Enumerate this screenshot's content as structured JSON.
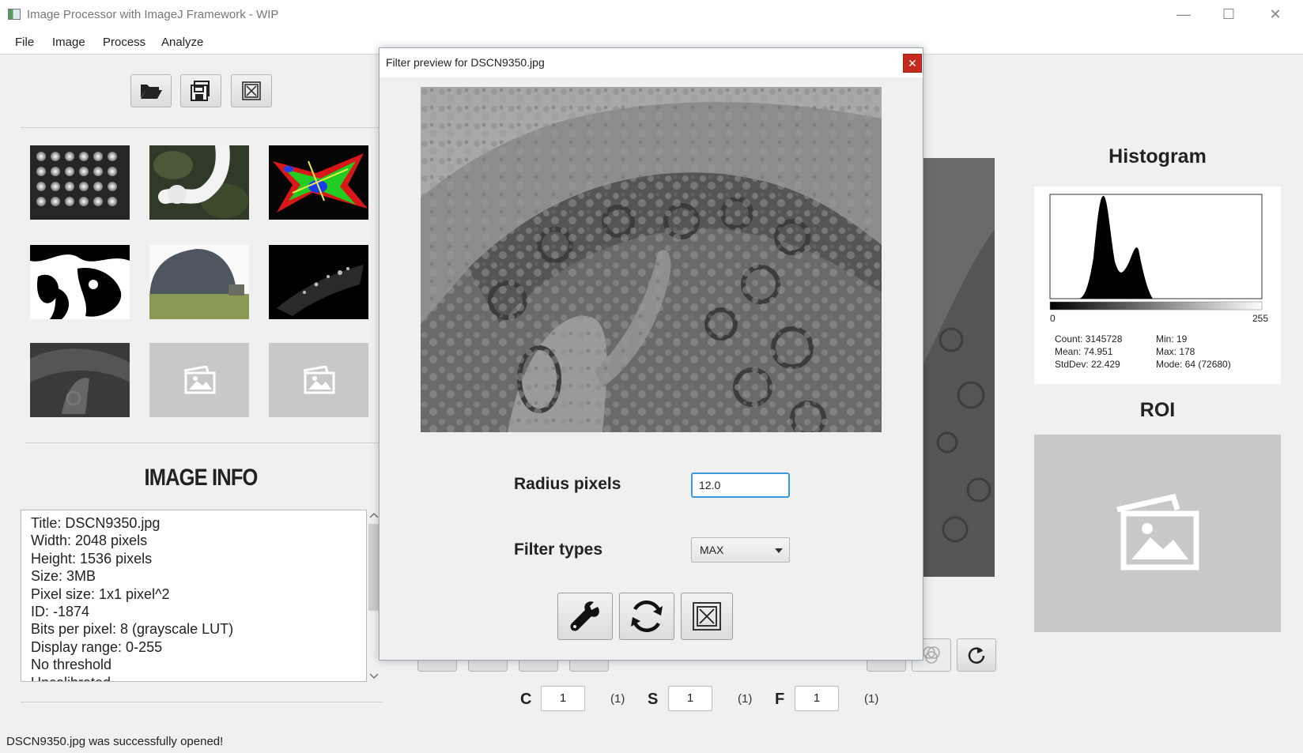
{
  "window": {
    "title": "Image Processor with ImageJ Framework - WIP",
    "minimize_glyph": "—",
    "maximize_glyph": "☐",
    "close_glyph": "✕"
  },
  "menu": [
    "File",
    "Image",
    "Process",
    "Analyze"
  ],
  "toolbar": {
    "open_icon": "folder-open-icon",
    "save_icon": "save-icon",
    "close_icon": "close-image-icon"
  },
  "thumbnails": [
    {
      "name": "dots-grid"
    },
    {
      "name": "white-flowers"
    },
    {
      "name": "fluorescent-cells"
    },
    {
      "name": "bw-portrait"
    },
    {
      "name": "tree-landscape"
    },
    {
      "name": "dark-particles"
    },
    {
      "name": "tissue-section"
    },
    {
      "name": "empty-slot"
    },
    {
      "name": "empty-slot"
    }
  ],
  "image_info": {
    "title": "IMAGE INFO",
    "lines": [
      "Title: DSCN9350.jpg",
      "Width:  2048 pixels",
      "Height:  1536 pixels",
      "Size:  3MB",
      "Pixel size: 1x1 pixel^2",
      "ID: -1874",
      "Bits per pixel: 8 (grayscale LUT)",
      "Display range: 0-255",
      "No threshold",
      "Uncalibrated"
    ]
  },
  "status": "DSCN9350.jpg was successfully opened!",
  "navigation": {
    "c_label": "C",
    "c_value": "1",
    "c_count": "(1)",
    "s_label": "S",
    "s_value": "1",
    "s_count": "(1)",
    "f_label": "F",
    "f_value": "1",
    "f_count": "(1)"
  },
  "histogram": {
    "title": "Histogram",
    "axis_min": "0",
    "axis_max": "255",
    "stats": {
      "count": "Count: 3145728",
      "mean": "Mean: 74.951",
      "stddev": "StdDev: 22.429",
      "min": "Min: 19",
      "max": "Max: 178",
      "mode": "Mode: 64 (72680)"
    }
  },
  "roi": {
    "title": "ROI"
  },
  "dialog": {
    "title": "Filter preview for DSCN9350.jpg",
    "close_glyph": "✕",
    "radius_label": "Radius pixels",
    "radius_value": "12.0",
    "filter_label": "Filter types",
    "filter_value": "MAX",
    "apply_icon": "wrench-icon",
    "refresh_icon": "refresh-icon",
    "cancel_icon": "close-box-icon"
  },
  "colors": {
    "accent": "#3a9ad9",
    "close_red": "#c42b1c",
    "placeholder_gray": "#c8c8c8"
  }
}
